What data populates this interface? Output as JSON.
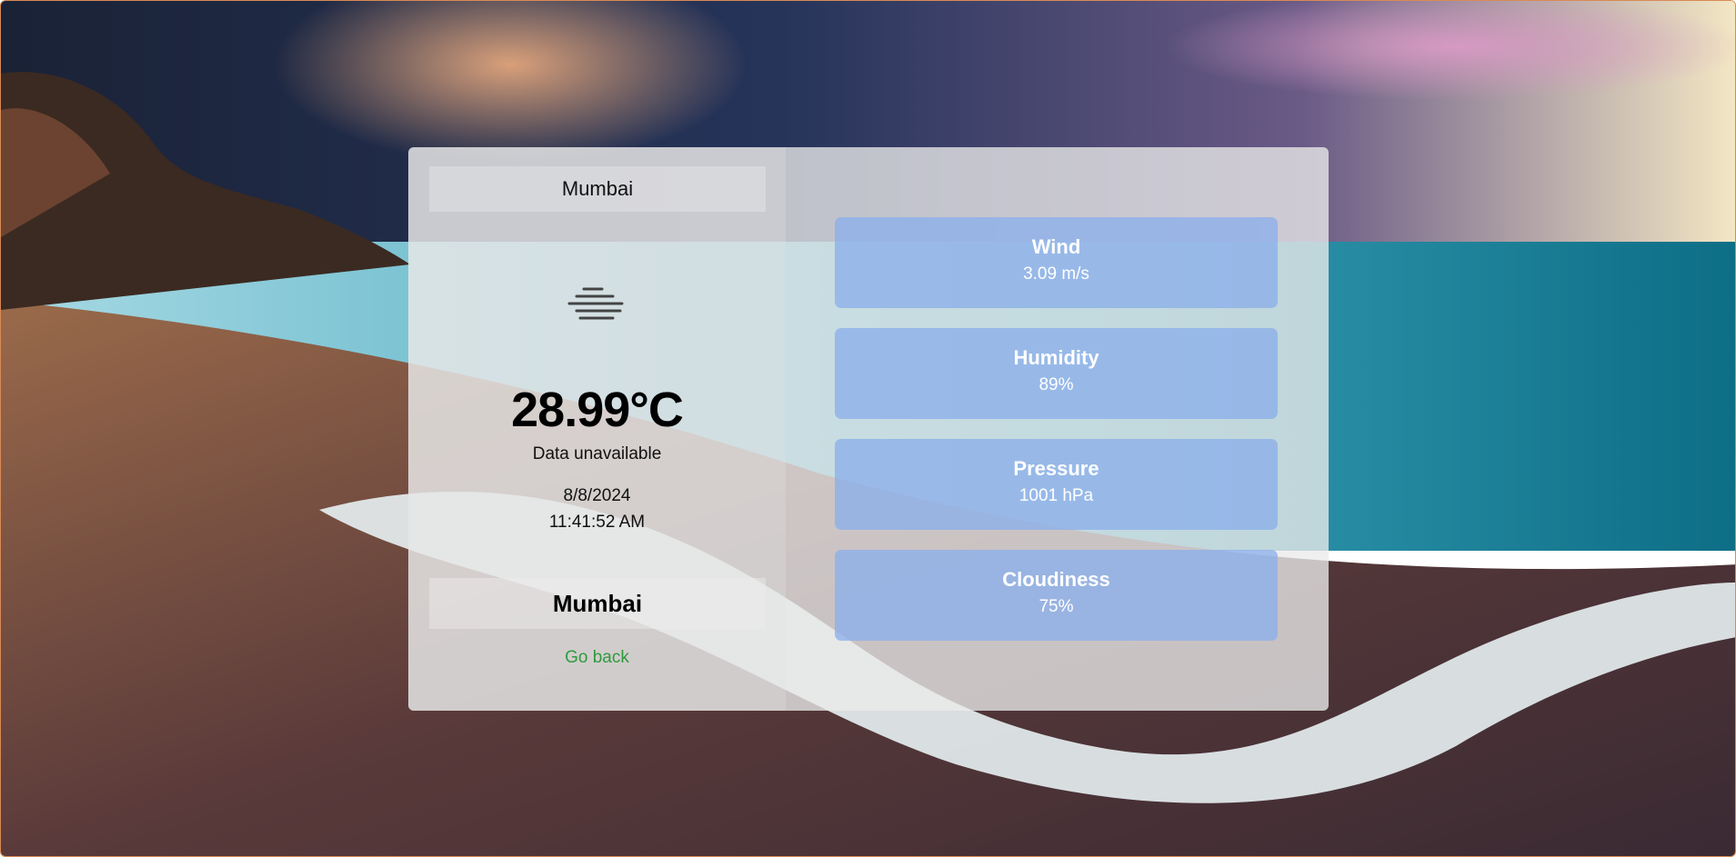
{
  "colors": {
    "card_bg": "#ebebeb",
    "stat_bg": "#8cafeb",
    "link": "#2e9b3e"
  },
  "location": {
    "city_top": "Mumbai",
    "city_bottom": "Mumbai"
  },
  "weather": {
    "icon": "mist-icon",
    "temperature": "28.99°C",
    "description": "Data unavailable",
    "date": "8/8/2024",
    "time": "11:41:52 AM"
  },
  "navigation": {
    "go_back_label": "Go back"
  },
  "stats": [
    {
      "label": "Wind",
      "value": "3.09 m/s"
    },
    {
      "label": "Humidity",
      "value": "89%"
    },
    {
      "label": "Pressure",
      "value": "1001 hPa"
    },
    {
      "label": "Cloudiness",
      "value": "75%"
    }
  ]
}
